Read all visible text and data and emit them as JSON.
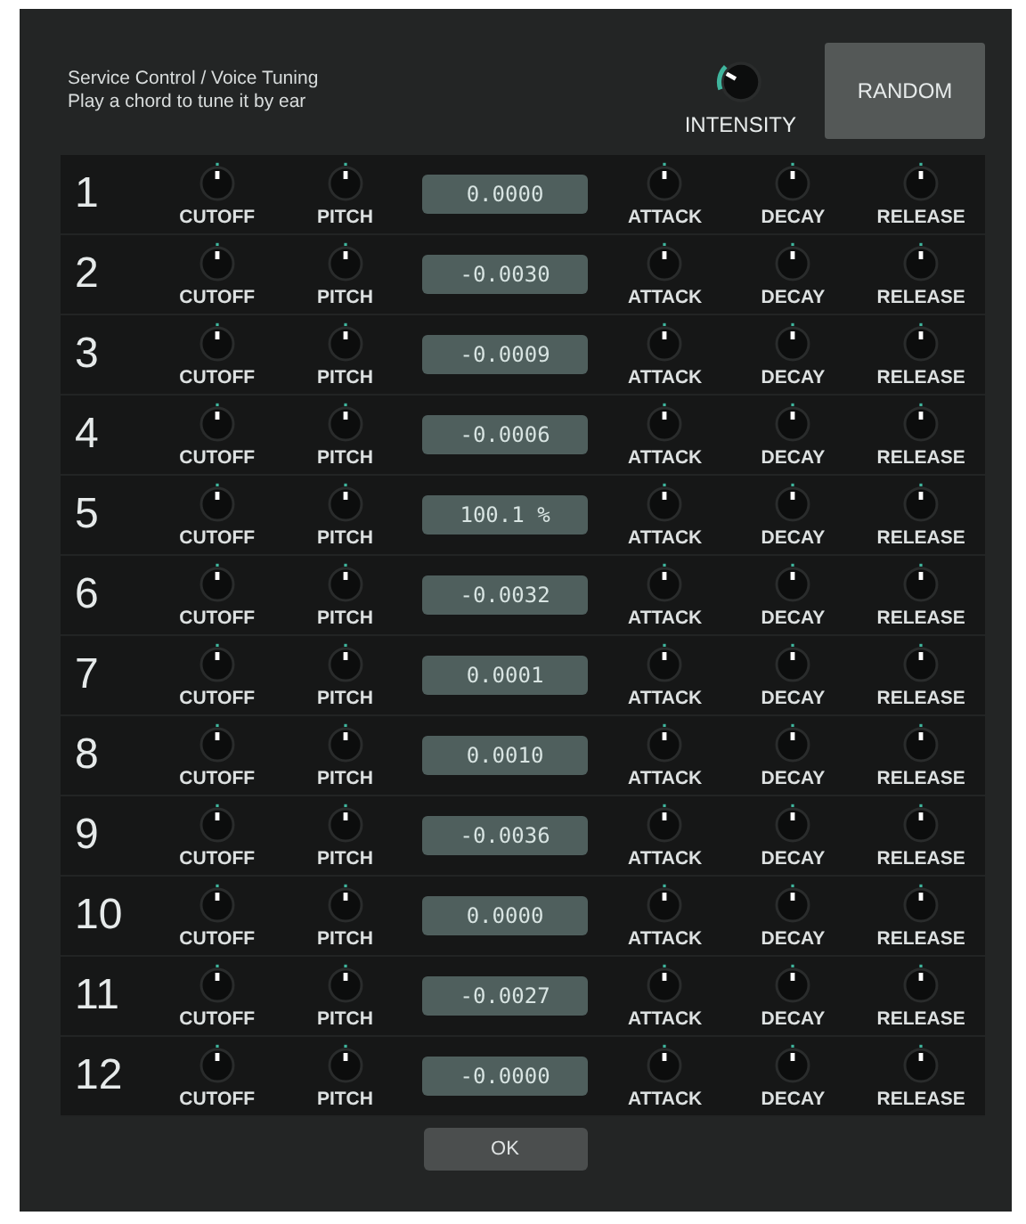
{
  "header": {
    "title": "Service Control / Voice Tuning",
    "subtitle": "Play a chord to tune it by ear"
  },
  "intensity_label": "INTENSITY",
  "random_button": "RANDOM",
  "voices": [
    {
      "number": "1",
      "value": "0.0000",
      "knobs": [
        "CUTOFF",
        "PITCH",
        "ATTACK",
        "DECAY",
        "RELEASE"
      ]
    },
    {
      "number": "2",
      "value": "-0.0030",
      "knobs": [
        "CUTOFF",
        "PITCH",
        "ATTACK",
        "DECAY",
        "RELEASE"
      ]
    },
    {
      "number": "3",
      "value": "-0.0009",
      "knobs": [
        "CUTOFF",
        "PITCH",
        "ATTACK",
        "DECAY",
        "RELEASE"
      ]
    },
    {
      "number": "4",
      "value": "-0.0006",
      "knobs": [
        "CUTOFF",
        "PITCH",
        "ATTACK",
        "DECAY",
        "RELEASE"
      ]
    },
    {
      "number": "5",
      "value": "100.1 %",
      "knobs": [
        "CUTOFF",
        "PITCH",
        "ATTACK",
        "DECAY",
        "RELEASE"
      ]
    },
    {
      "number": "6",
      "value": "-0.0032",
      "knobs": [
        "CUTOFF",
        "PITCH",
        "ATTACK",
        "DECAY",
        "RELEASE"
      ]
    },
    {
      "number": "7",
      "value": "0.0001",
      "knobs": [
        "CUTOFF",
        "PITCH",
        "ATTACK",
        "DECAY",
        "RELEASE"
      ]
    },
    {
      "number": "8",
      "value": "0.0010",
      "knobs": [
        "CUTOFF",
        "PITCH",
        "ATTACK",
        "DECAY",
        "RELEASE"
      ]
    },
    {
      "number": "9",
      "value": "-0.0036",
      "knobs": [
        "CUTOFF",
        "PITCH",
        "ATTACK",
        "DECAY",
        "RELEASE"
      ]
    },
    {
      "number": "10",
      "value": "0.0000",
      "knobs": [
        "CUTOFF",
        "PITCH",
        "ATTACK",
        "DECAY",
        "RELEASE"
      ]
    },
    {
      "number": "11",
      "value": "-0.0027",
      "knobs": [
        "CUTOFF",
        "PITCH",
        "ATTACK",
        "DECAY",
        "RELEASE"
      ]
    },
    {
      "number": "12",
      "value": "-0.0000",
      "knobs": [
        "CUTOFF",
        "PITCH",
        "ATTACK",
        "DECAY",
        "RELEASE"
      ]
    }
  ],
  "ok_button": "OK"
}
